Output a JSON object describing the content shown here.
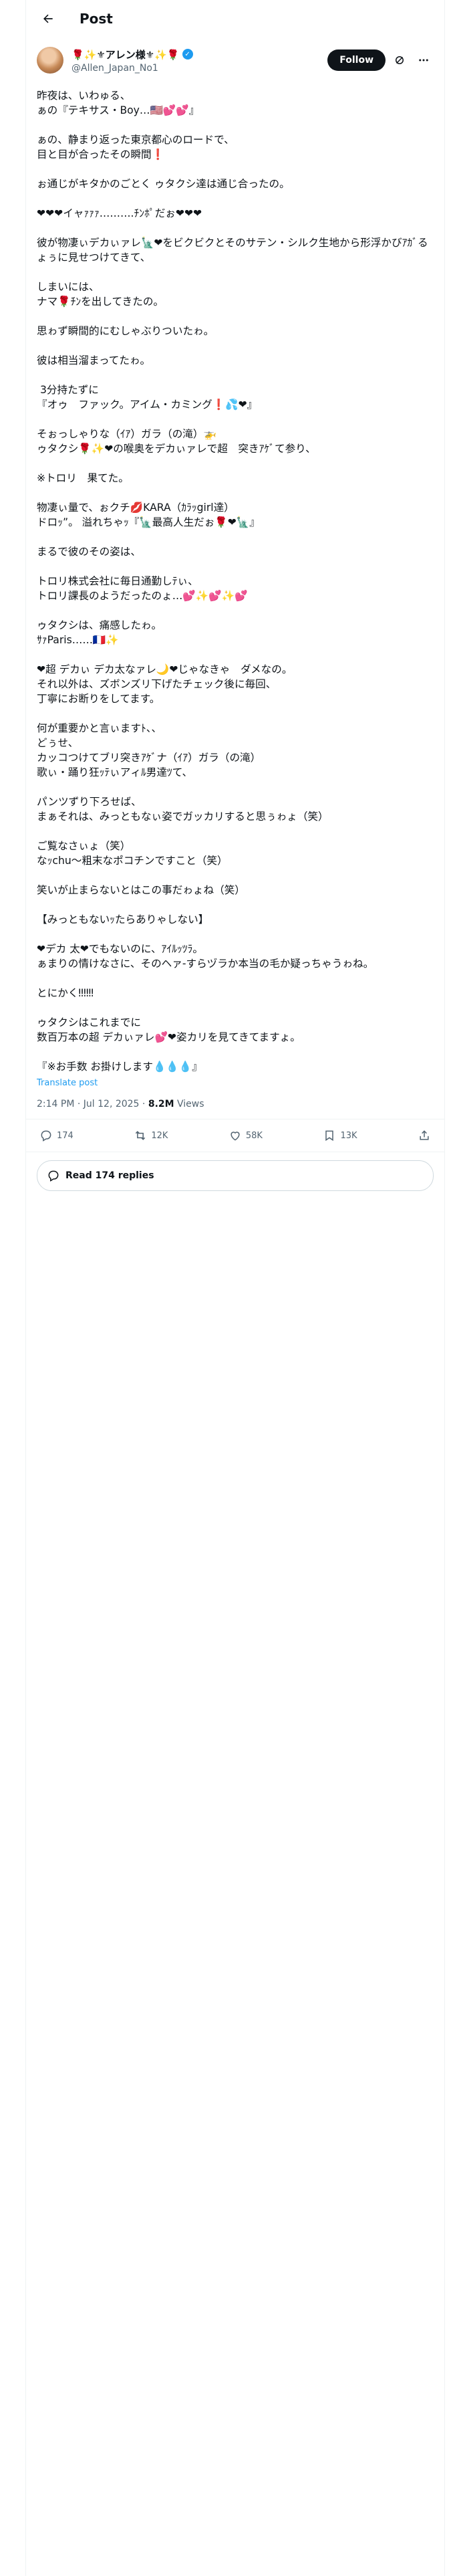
{
  "header": {
    "title": "Post"
  },
  "author": {
    "display_name": "🌹✨⚜アレン様⚜✨🌹",
    "handle": "@Allen_Japan_No1",
    "follow_label": "Follow"
  },
  "post": {
    "text": "昨夜は、いわゅる、\nぁの『テキサス・Boy…🇺🇸💕💕』\n\nぁの、静まり返った東京都心のロードで、\n目と目が合ったその瞬間❗\n\nぉ通じがキタかのごとく ゥタクシ達は通じ合ったの。\n\n❤❤❤イャｧｧｧ……….ﾁﾝﾎﾟだぉ❤❤❤\n\n彼が物凄ぃデカぃァレ🗽❤をビクビクとそのサテン・シルク生地から形浮かびｱｶﾞるょぅに見せつけてきて、\n\nしまいには、\nナマ🌹ﾁﾝを出してきたの。\n\n思ゎず瞬間的にむしゃぶりついたゎ。\n\n彼は相当溜まってたゎ。\n\n 3分持たずに\n『オゥ　ファック。アイム・カミング❗💦❤』\n\nそぉっしゃりな（ｲｱ）ガラ（の滝）🚁\nゥタクシ🌹✨❤の喉奥をデカぃァレで超　突きｱｹﾞて参り、\n\n※トロリ　果てた。\n\n物凄ぃ量で、ぉクチ💋KARA（ｶﾗｯgirl達）\nドロｯ”。 溢れちゃｯ『🗽最高人生だぉ🌹❤🗽』\n\nまるで彼のその姿は、\n\nトロリ株式会社に毎日通勤しﾃぃ、\nトロリ課長のようだったのょ…💕✨💕✨💕\n\nゥタクシは、痛感したゎ。\nｻｧParis……🇫🇷✨\n\n❤超 デカぃ デカ太なァレ🌙❤じゃなきゃ　ダメなの。\nそれ以外は、ズボンズリ下げたチェック後に毎回、\n丁寧にお断りをしてます。\n\n何が重要かと言ぃますﾄ、、\nどぅせ、\nカッコつけてブリ突きｱｹﾞナ（ｲｱ）ガラ（の滝）\n歌ぃ・踊り狂ｯﾃぃアィﾙ男達ﾂて、\n\nパンツずり下ろせば、\nまぁそれは、みっともなぃ姿でガッカリすると思ぅゎょ（笑）\n\nご覧なさぃょ（笑）\nなｯchu〜粗末なポコチンですこと（笑）\n\n笑いが止まらないとはこの事だゎょね（笑）\n\n【みっともないｯたらありゃしない】\n\n❤デカ 太❤でもないのに、ｱｲﾙｯﾂﾗ。\nぁまりの情けなさに、そのヘァ-すらヅラか本当の毛か疑っちゃうゎね。\n\nとにかく‼‼‼\n\nゥタクシはこれまでに\n数百万本の超 デカぃァレ💕❤姿カリを見てきてますょ。\n\n『※お手数 お掛けします💧💧💧』",
    "translate_label": "Translate post",
    "time": "2:14 PM",
    "date": "Jul 12, 2025",
    "separator": "·",
    "views_count": "8.2M",
    "views_label": "Views"
  },
  "actions": {
    "replies": "174",
    "reposts": "12K",
    "likes": "58K",
    "bookmarks": "13K"
  },
  "read_replies_label": "Read 174 replies",
  "icons": {
    "back": "arrow-left-icon",
    "grok": "grok-icon",
    "more": "more-icon",
    "reply": "reply-icon",
    "repost": "repost-icon",
    "like": "heart-icon",
    "bookmark": "bookmark-icon",
    "share": "share-icon",
    "verified": "verified-badge-icon"
  },
  "colors": {
    "accent": "#1d9bf0",
    "text": "#0f1419",
    "muted": "#536471",
    "border": "#eff3f4"
  }
}
